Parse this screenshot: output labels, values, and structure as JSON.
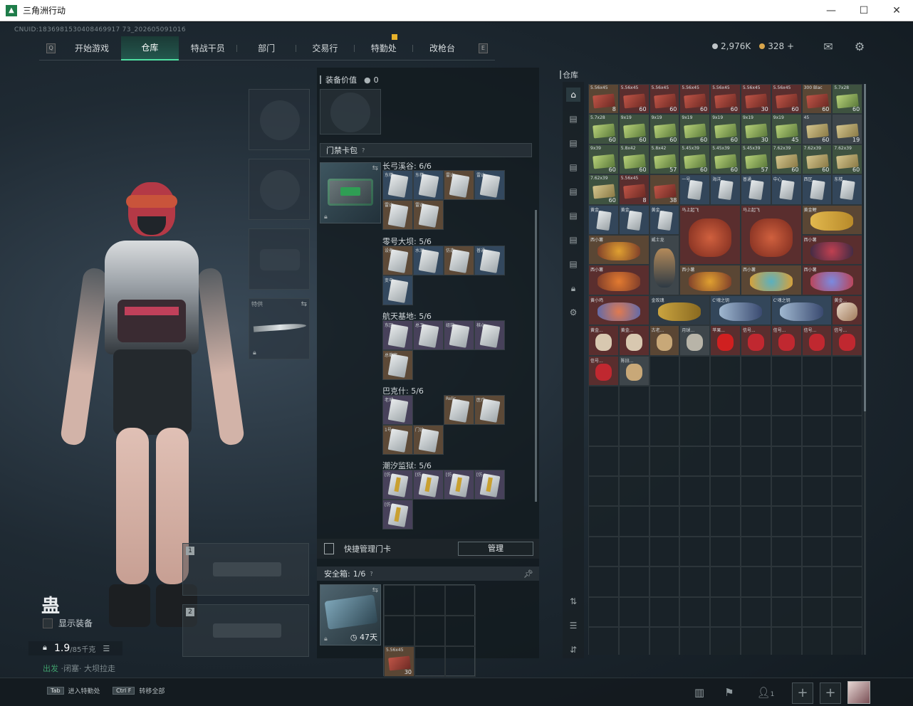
{
  "window": {
    "title": "三角洲行动",
    "min_label": "—",
    "max_label": "☐",
    "close_label": "✕"
  },
  "cnuid": "CNUID:1836981530408469917 73_202605091016",
  "nav": {
    "tabs": [
      "开始游戏",
      "仓库",
      "特战干员",
      "部门",
      "交易行",
      "特勤处",
      "改枪台"
    ],
    "active": "仓库",
    "left_key": "Q",
    "right_key": "E"
  },
  "currency": {
    "silver": "2,976K",
    "gold": "328",
    "plus": "+"
  },
  "icons": {
    "mail": "mail-icon",
    "settings": "gear-icon"
  },
  "equipment": {
    "knife_label": "特供",
    "slot1_num": "1",
    "slot2_num": "2"
  },
  "player": {
    "name_glyph": "蛊",
    "show_equip": "显示装备",
    "weight": "1.9",
    "weight_max": "/85千克",
    "status_a": "出发",
    "status_b": "·闭塞·",
    "status_c": "大坝拉走"
  },
  "middle": {
    "equip_value_label": "装备价值",
    "equip_value": "0",
    "keycase_title": "门禁卡包",
    "keycase_help": "?",
    "maps": [
      {
        "name": "长弓溪谷: 6/6",
        "cards": [
          [
            "东楼...",
            "blue"
          ],
          [
            "东楼...",
            "blue"
          ],
          [
            "雷达...",
            "brown"
          ],
          [
            "雷达...",
            "blue"
          ],
          [
            "雷达...",
            "brown"
          ],
          [
            "雷达...",
            "brown"
          ]
        ]
      },
      {
        "name": "零号大坝: 5/6",
        "cards": [
          [
            "设备...",
            "brown"
          ],
          [
            "水泥...",
            "blue"
          ],
          [
            "仿造...",
            "brown"
          ],
          [
            "普通...",
            "blue"
          ],
          [
            "变电...",
            "blue"
          ]
        ]
      },
      {
        "name": "航天基地: 5/6",
        "cards": [
          [
            "东区...",
            "purple"
          ],
          [
            "总工...",
            "purple"
          ],
          [
            "组装...",
            "purple"
          ],
          [
            "核心...",
            "purple"
          ],
          [
            "总裁室...",
            "brown"
          ]
        ]
      },
      {
        "name": "巴克什: 5/6",
        "cards": [
          [
            "老城...",
            "purple"
          ],
          [
            "",
            "empty"
          ],
          [
            "Relic...",
            "brown"
          ],
          [
            "医疗...",
            "brown"
          ],
          [
            "1号...",
            "brown"
          ],
          [
            "门诊...",
            "brown"
          ]
        ]
      },
      {
        "name": "潮汐监狱: 5/6",
        "cards": [
          [
            "[仿...",
            "purple"
          ],
          [
            "[仿...",
            "purple"
          ],
          [
            "[仿...",
            "purple"
          ],
          [
            "[仿...",
            "purple"
          ],
          [
            "[仿...",
            "purple"
          ]
        ]
      }
    ],
    "quick_manage": "快捷管理门卡",
    "manage_btn": "管理",
    "safe_label": "安全箱:",
    "safe_value": "1/6",
    "safe_help": "?",
    "safe_days": "47天",
    "safe_item_label": "5.56x45",
    "safe_item_count": "30"
  },
  "warehouse": {
    "title": "仓库",
    "rows": [
      [
        [
          "5.56x45",
          "brown",
          "red",
          "8"
        ],
        [
          "5.56x45",
          "red",
          "red",
          "60"
        ],
        [
          "5.56x45",
          "red",
          "red",
          "60"
        ],
        [
          "5.56x45",
          "red",
          "red",
          "60"
        ],
        [
          "5.56x45",
          "red",
          "red",
          "60"
        ],
        [
          "5.56x45",
          "red",
          "red",
          "30"
        ],
        [
          "5.56x45",
          "red",
          "red",
          "60"
        ],
        [
          "300 Blac",
          "brown",
          "red",
          "60"
        ],
        [
          "5.7x28",
          "green",
          "green",
          "60"
        ]
      ],
      [
        [
          "5.7x28",
          "green",
          "green",
          "60"
        ],
        [
          "9x19",
          "green",
          "green",
          "60"
        ],
        [
          "9x19",
          "green",
          "green",
          "60"
        ],
        [
          "9x19",
          "green",
          "green",
          "60"
        ],
        [
          "9x19",
          "green",
          "green",
          "60"
        ],
        [
          "9x19",
          "green",
          "green",
          "30"
        ],
        [
          "9x19",
          "green",
          "green",
          "45"
        ],
        [
          "45",
          "gray",
          "tan",
          "60"
        ],
        [
          "",
          "gray",
          "tan",
          "19"
        ]
      ],
      [
        [
          "9x39",
          "green",
          "green",
          "60"
        ],
        [
          "5.8x42",
          "green",
          "green",
          "60"
        ],
        [
          "5.8x42",
          "green",
          "green",
          "57"
        ],
        [
          "5.45x39",
          "green",
          "green",
          "60"
        ],
        [
          "5.45x39",
          "green",
          "green",
          "60"
        ],
        [
          "5.45x39",
          "green",
          "green",
          "57"
        ],
        [
          "7.62x39",
          "green",
          "tan",
          "60"
        ],
        [
          "7.62x39",
          "green",
          "tan",
          "60"
        ],
        [
          "7.62x39",
          "green",
          "tan",
          "60"
        ]
      ],
      [
        [
          "7.62x39",
          "green",
          "tan",
          "60"
        ],
        [
          "5.56x45",
          "red",
          "red",
          "8"
        ],
        [
          "",
          "brown",
          "red",
          "38"
        ],
        [
          "一号...",
          "blue",
          "card",
          ""
        ],
        [
          "海洋...",
          "blue",
          "card",
          ""
        ],
        [
          "普通...",
          "blue",
          "card",
          ""
        ],
        [
          "中心...",
          "blue",
          "card",
          ""
        ],
        [
          "西区...",
          "blue",
          "card",
          ""
        ],
        [
          "东楼...",
          "blue",
          "card",
          ""
        ]
      ]
    ],
    "row4": [
      [
        "黄金...",
        "blue",
        "card",
        ""
      ],
      [
        "黄金...",
        "blue",
        "card",
        ""
      ],
      [
        "黄金...",
        "blue",
        "card",
        ""
      ]
    ],
    "big_items": {
      "horse1": "马上起飞",
      "horse2": "马上起飞",
      "fish": "黄金鲤",
      "ornament_a": "西小薯",
      "doll": "威士龙",
      "ornament_b": "西小薯",
      "mask_a": "西小薯",
      "mask_b": "西小薯",
      "mask_c": "西小薯",
      "mask_d": "西小薯",
      "egg": "黄小鸡",
      "rose": "金玫瑰",
      "key_a": "C'魂之钥",
      "key_b": "C'魂之钥",
      "ticket": "黄金..."
    },
    "row_small": [
      [
        "黄金...",
        "red"
      ],
      [
        "黄金...",
        "red"
      ],
      [
        "古老...",
        "brown"
      ],
      [
        "月球...",
        "gray"
      ],
      [
        "苹果...",
        "red"
      ],
      [
        "信号...",
        "red"
      ],
      [
        "信号...",
        "red"
      ],
      [
        "信号...",
        "red"
      ],
      [
        "信号...",
        "red"
      ]
    ],
    "row_last": [
      [
        "信号...",
        "red"
      ],
      [
        "陈旧...",
        "gray"
      ]
    ]
  },
  "bottom": {
    "hint1_key": "Tab",
    "hint1": "进入特勤处",
    "hint2_key": "Ctrl F",
    "hint2": "转移全部",
    "team_count": "1",
    "plus": "+"
  }
}
